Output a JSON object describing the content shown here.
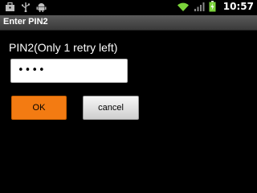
{
  "status_bar": {
    "left_icons": [
      "briefcase-icon",
      "usb-icon",
      "android-icon"
    ],
    "right_icons": [
      "wifi-icon",
      "signal-icon",
      "battery-charging-icon"
    ],
    "time": "10:57"
  },
  "dialog": {
    "title": "Enter PIN2",
    "prompt": "PIN2(Only 1 retry left)",
    "pin_value": "••••",
    "ok_label": "OK",
    "cancel_label": "cancel"
  },
  "colors": {
    "accent_ok": "#f37b12",
    "wifi": "#7ad23a",
    "battery": "#7ad23a"
  }
}
